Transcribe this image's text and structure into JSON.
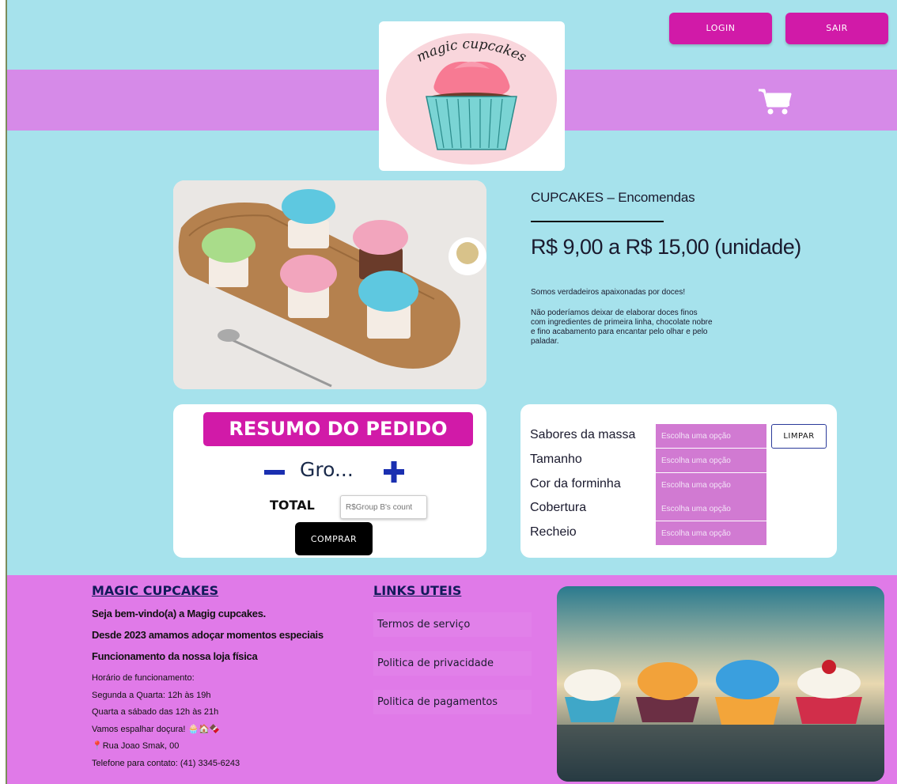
{
  "header": {
    "login_label": "LOGIN",
    "logout_label": "SAIR",
    "logo_text": "magic cupcakes",
    "colors": {
      "accent": "#d11aa8",
      "band": "#d68ae8",
      "background": "#a6e2ec"
    }
  },
  "product": {
    "category": "CUPCAKES – Encomendas",
    "price": "R$ 9,00 a R$ 15,00  (unidade)",
    "desc_1": "Somos verdadeiros apaixonadas por doces!",
    "desc_2": "Não poderíamos deixar de elaborar doces finos com ingredientes de primeira linha, chocolate nobre e fino acabamento para encantar pelo olhar e pelo paladar."
  },
  "summary": {
    "title": "RESUMO DO PEDIDO",
    "quantity": "Gro...",
    "total_label": "TOTAL",
    "total_placeholder": "R$Group B's count",
    "buy_label": "COMPRAR"
  },
  "options": {
    "clear_label": "LIMPAR",
    "placeholder": "Escolha uma opção",
    "rows": [
      {
        "label": "Sabores da massa"
      },
      {
        "label": "Tamanho"
      },
      {
        "label": "Cor da forminha"
      },
      {
        "label": "Cobertura"
      },
      {
        "label": "Recheio"
      }
    ]
  },
  "footer": {
    "brand_title": "MAGIC CUPCAKES",
    "welcome": "Seja bem-vindo(a) a Magig cupcakes.",
    "since": "Desde 2023 amamos adoçar momentos especiais",
    "store_hours_title": "Funcionamento da nossa loja física",
    "hours": [
      "Horário de funcionamento:",
      "Segunda a Quarta: 12h às 19h",
      "Quarta a sábado das 12h às 21h",
      "Vamos espalhar doçura! 🧁🏠🍫",
      "📍Rua Joao Smak, 00",
      "Telefone para contato: (41) 3345-6243"
    ],
    "links_title": "LINKS UTEIS",
    "links": [
      "Termos de serviço",
      "Politica de privacidade",
      "Politica de pagamentos"
    ]
  }
}
